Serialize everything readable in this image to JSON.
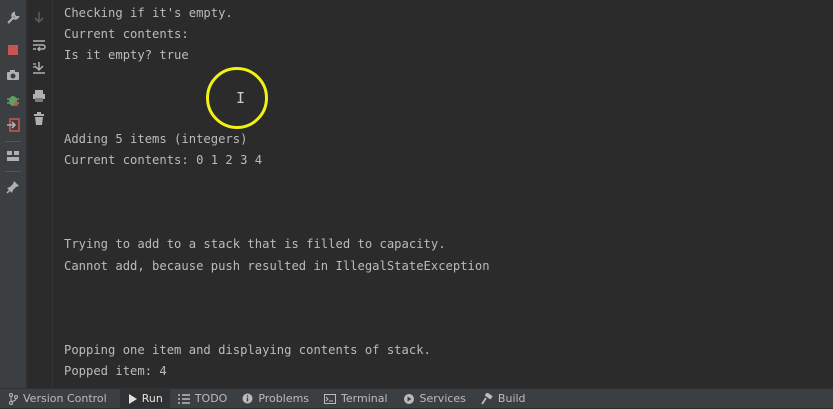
{
  "left_toolbar_icons": [
    "wrench-icon",
    "stop-icon",
    "camera-icon",
    "debug-icon",
    "exit-icon",
    "layout-icon",
    "pin-icon"
  ],
  "console_toolbar_icons": [
    "down-arrow-icon",
    "soft-wrap-icon",
    "scroll-to-end-icon",
    "print-icon",
    "trash-icon"
  ],
  "console": {
    "lines": [
      "Checking if it's empty.",
      "Current contents:",
      "Is it empty? true",
      "Adding 5 items (integers)",
      "Current contents: 0 1 2 3 4",
      "Trying to add to a stack that is filled to capacity.",
      "Cannot add, because push resulted in IllegalStateException",
      "Popping one item and displaying contents of stack.",
      "Popped item: 4"
    ]
  },
  "statusbar": {
    "tabs": [
      {
        "label": "Version Control",
        "icon": "branch-icon",
        "active": false
      },
      {
        "label": "Run",
        "icon": "run-icon",
        "active": true
      },
      {
        "label": "TODO",
        "icon": "list-icon",
        "active": false
      },
      {
        "label": "Problems",
        "icon": "info-icon",
        "active": false
      },
      {
        "label": "Terminal",
        "icon": "terminal-icon",
        "active": false
      },
      {
        "label": "Services",
        "icon": "services-icon",
        "active": false
      },
      {
        "label": "Build",
        "icon": "hammer-icon",
        "active": false
      }
    ]
  },
  "colors": {
    "background": "#2b2b2b",
    "toolbar": "#3c3f41",
    "text": "#bbbbbb",
    "stop_red": "#c75450",
    "cursor_highlight": "#f1f117"
  }
}
